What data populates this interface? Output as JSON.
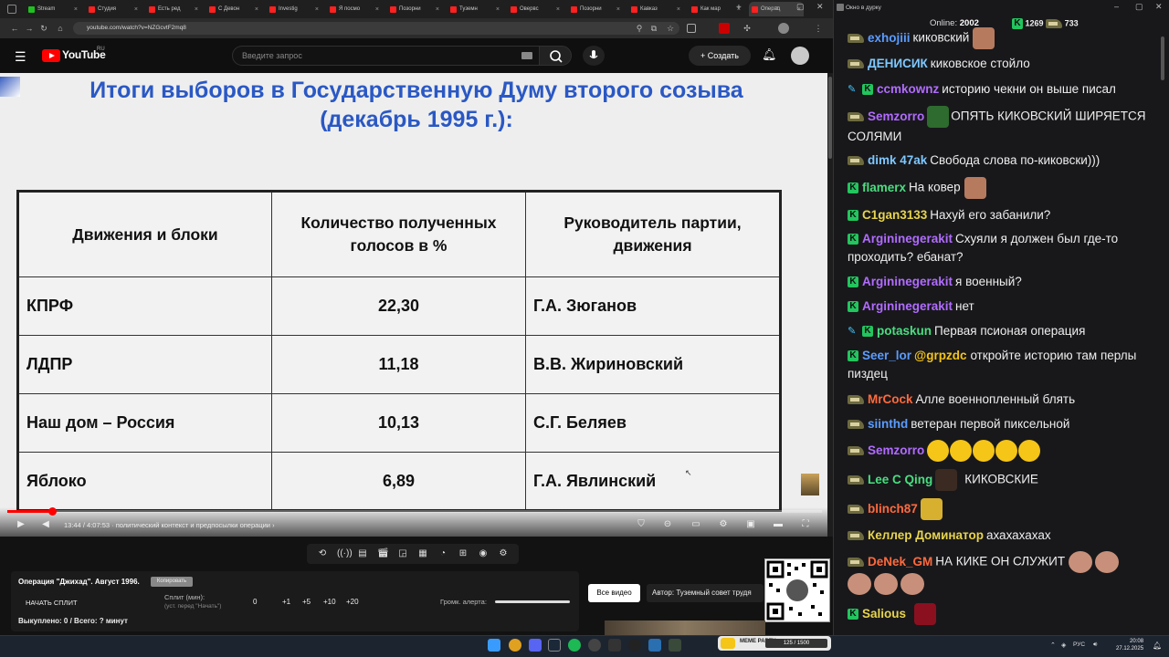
{
  "browser": {
    "tabs": [
      {
        "label": "Stream",
        "color": "#20c020",
        "active": false
      },
      {
        "label": "Студия",
        "color": "#ff2020",
        "active": false
      },
      {
        "label": "Есть ред",
        "color": "#ff2020",
        "active": false
      },
      {
        "label": "С Девон",
        "color": "#ff2020",
        "active": false
      },
      {
        "label": "Investig",
        "color": "#ff2020",
        "active": false
      },
      {
        "label": "Я посмо",
        "color": "#ff2020",
        "active": false
      },
      {
        "label": "Позорни",
        "color": "#ff2020",
        "active": false
      },
      {
        "label": "Туземн",
        "color": "#ff2020",
        "active": false
      },
      {
        "label": "Овервс",
        "color": "#ff2020",
        "active": false
      },
      {
        "label": "Позорни",
        "color": "#ff2020",
        "active": false
      },
      {
        "label": "Кавказ",
        "color": "#ff2020",
        "active": false
      },
      {
        "label": "Как мар",
        "color": "#ff2020",
        "active": false
      },
      {
        "label": "Операц",
        "color": "#ff2020",
        "active": true
      }
    ],
    "url": "youtube.com/watch?v=NZGcvtF2mq8"
  },
  "youtube": {
    "logo_text": "YouTube",
    "region": "RU",
    "search_placeholder": "Введите запрос",
    "create_label": "Создать"
  },
  "slide": {
    "title_line1": "Итоги выборов в Государственную Думу второго созыва",
    "title_line2": "(декабрь 1995 г.):",
    "headers": [
      "Движения и блоки",
      "Количество полученных голосов в %",
      "Руководитель партии, движения"
    ],
    "rows": [
      [
        "КПРФ",
        "22,30",
        "Г.А. Зюганов"
      ],
      [
        "ЛДПР",
        "11,18",
        "В.В. Жириновский"
      ],
      [
        "Наш дом – Россия",
        "10,13",
        "С.Г. Беляев"
      ],
      [
        "Яблоко",
        "6,89",
        "Г.А. Явлинский"
      ]
    ]
  },
  "player": {
    "time": "13:44 / 4:07:53",
    "chapter": "· политический контекст и предпосылки операции",
    "progress_fraction": 0.055
  },
  "panel": {
    "title": "Операция \"Джихад\". Август 1996.",
    "copy_label": "Копировать",
    "start_split": "НАЧАТЬ СПЛИТ",
    "split_label": "Сплит (мин):",
    "split_hint": "(уст. перед \"Начать\")",
    "split_values": [
      "0",
      "+1",
      "+5",
      "+10",
      "+20"
    ],
    "alert_label": "Громк. алерта:",
    "bought": "Выкуплено: 0 / Всего: ? минут",
    "all_video": "Все видео",
    "author": "Автор: Туземный совет трудя"
  },
  "meme": {
    "label": "MEME PARTY",
    "progress": "125 / 1500"
  },
  "taskbar": {
    "lang": "РУС",
    "time": "20:08",
    "date": "27.12.2025"
  },
  "chat": {
    "window_title": "Окно в дурку",
    "online_label": "Online:",
    "online_count": "2002",
    "points1": "1269",
    "points2": "733",
    "messages": [
      {
        "user": "exhojiii",
        "color": "#5b9cff",
        "text": "киковский",
        "badge": "cap",
        "emote": "face"
      },
      {
        "user": "ДЕНИСИК",
        "color": "#7ec8ff",
        "text": "киковское стойло",
        "badge": "cap"
      },
      {
        "user": "ccmkownz",
        "color": "#b16cff",
        "text": "историю чекни он выше писал",
        "badge": "penk"
      },
      {
        "user": "Semzorro",
        "color": "#b16cff",
        "text": "ОПЯТЬ КИКОВСКИЙ ШИРЯЕТСЯ СОЛЯМИ",
        "badge": "cap",
        "emote": "tree"
      },
      {
        "user": "dimk 47ak",
        "color": "#7ec8ff",
        "text": "Свобода слова по-киковски)))",
        "badge": "cap"
      },
      {
        "user": "flamerx",
        "color": "#4ade80",
        "text": "На ковер",
        "badge": "k",
        "emote": "face"
      },
      {
        "user": "C1gan3133",
        "color": "#e8d44d",
        "text": "Нахуй его забанили?",
        "badge": "k"
      },
      {
        "user": "Argininegerakit",
        "color": "#b16cff",
        "text": "Схуяли я должен был где-то проходить? ебанат?",
        "badge": "k"
      },
      {
        "user": "Argininegerakit",
        "color": "#b16cff",
        "text": "я военный?",
        "badge": "k"
      },
      {
        "user": "Argininegerakit",
        "color": "#b16cff",
        "text": "нет",
        "badge": "k"
      },
      {
        "user": "potaskun",
        "color": "#4ade80",
        "text": "Первая псионая операция",
        "badge": "penk"
      },
      {
        "user": "Seer_lor",
        "color": "#5b9cff",
        "text": "откройте историю там перлы пиздец",
        "mention": "@grpzdc",
        "badge": "k"
      },
      {
        "user": "MrCock",
        "color": "#ff6a3d",
        "text": "Алле военнопленный блять",
        "badge": "cap"
      },
      {
        "user": "siinthd",
        "color": "#5b9cff",
        "text": "ветеран первой пиксельной",
        "badge": "cap"
      },
      {
        "user": "Semzorro",
        "color": "#b16cff",
        "text": "",
        "badge": "cap",
        "emote": "laugh5"
      },
      {
        "user": "Lee C Qing",
        "color": "#4ade80",
        "text": "КИКОВСКИЕ",
        "badge": "cap",
        "emote": "dark"
      },
      {
        "user": "blinch87",
        "color": "#ff6a3d",
        "text": "",
        "badge": "cap",
        "emote": "pepe"
      },
      {
        "user": "Келлер Доминатор",
        "color": "#e8d44d",
        "text": "ахахахахах",
        "badge": "cap"
      },
      {
        "user": "DeNek_GM",
        "color": "#ff6a3d",
        "text": "НА КИКЕ ОН СЛУЖИТ",
        "badge": "cap",
        "emote": "faces5"
      },
      {
        "user": "Salious",
        "color": "#e8d44d",
        "text": "",
        "badge": "k",
        "emote": "red"
      }
    ]
  }
}
